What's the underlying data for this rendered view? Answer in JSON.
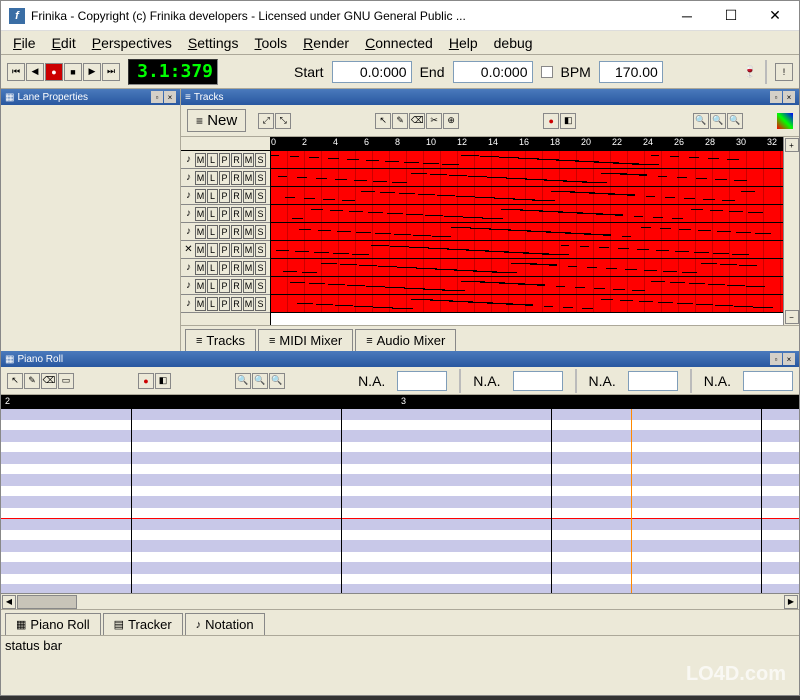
{
  "window": {
    "title": "Frinika - Copyright (c) Frinika developers - Licensed under GNU General Public ..."
  },
  "menubar": [
    "File",
    "Edit",
    "Perspectives",
    "Settings",
    "Tools",
    "Render",
    "Connected",
    "Help",
    "debug"
  ],
  "transport": {
    "time_display": "3.1:379",
    "start_label": "Start",
    "start_value": "0.0:000",
    "end_label": "End",
    "end_value": "0.0:000",
    "bpm_label": "BPM",
    "bpm_value": "170.00"
  },
  "panels": {
    "lane_properties": {
      "title": "Lane Properties"
    },
    "tracks": {
      "title": "Tracks",
      "new_button": "New"
    },
    "piano_roll": {
      "title": "Piano Roll"
    }
  },
  "track_header_buttons": [
    "M",
    "L",
    "P",
    "R",
    "M",
    "S"
  ],
  "track_count": 9,
  "ruler_ticks": [
    0,
    2,
    4,
    6,
    8,
    10,
    12,
    14,
    16,
    18,
    20,
    22,
    24,
    26,
    28,
    30,
    32
  ],
  "tracks_tabs": [
    {
      "icon": "≡",
      "label": "Tracks"
    },
    {
      "icon": "≡",
      "label": "MIDI Mixer"
    },
    {
      "icon": "≡",
      "label": "Audio Mixer"
    }
  ],
  "piano_roll_fields": {
    "na_label": "N.A."
  },
  "bottom_tabs": [
    {
      "icon": "▦",
      "label": "Piano Roll"
    },
    {
      "icon": "▤",
      "label": "Tracker"
    },
    {
      "icon": "♪",
      "label": "Notation"
    }
  ],
  "statusbar": "status bar",
  "watermark": "LO4D.com"
}
